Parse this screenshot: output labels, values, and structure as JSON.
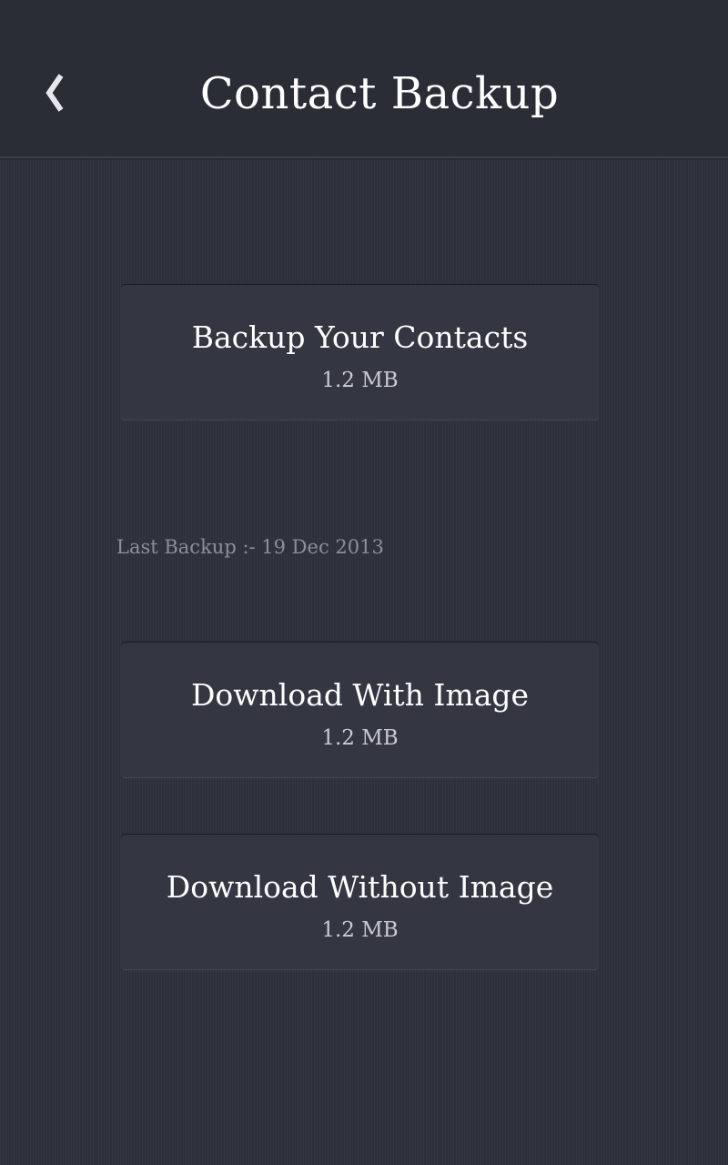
{
  "header": {
    "title": "Contact Backup",
    "back_icon": "chevron-left-icon"
  },
  "cards": [
    {
      "title": "Backup Your Contacts",
      "size": "1.2 MB"
    },
    {
      "title": "Download With Image",
      "size": "1.2 MB"
    },
    {
      "title": "Download Without Image",
      "size": "1.2 MB"
    }
  ],
  "last_backup": "Last Backup :- 19 Dec 2013",
  "colors": {
    "background": "#2f323d",
    "header": "#2a2c36",
    "card": "#343642",
    "text": "#ffffff",
    "muted_text": "#8d8f99"
  }
}
